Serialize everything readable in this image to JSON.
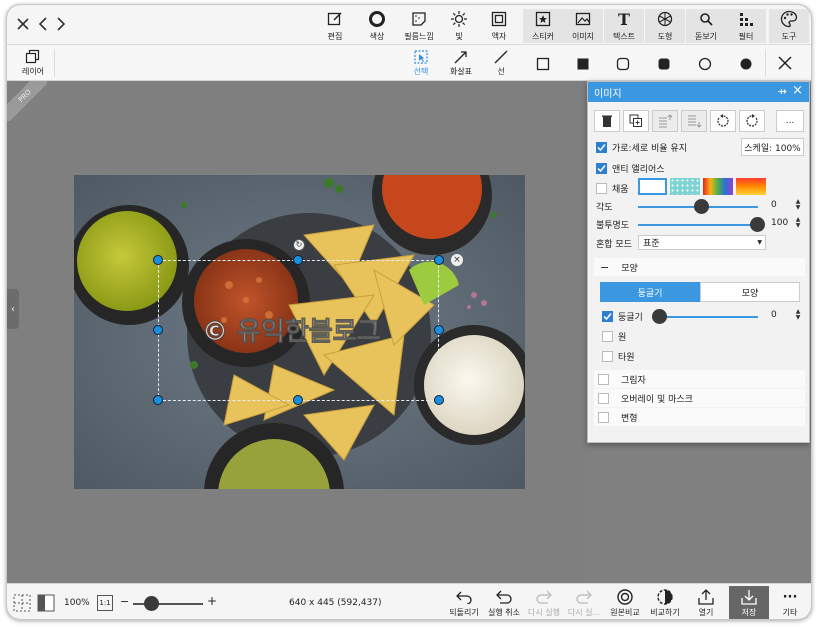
{
  "toolbar": {
    "tools": [
      {
        "icon": "edit-icon",
        "label": "편집"
      },
      {
        "icon": "color-ring-icon",
        "label": "색상"
      },
      {
        "icon": "film-grain-icon",
        "label": "필름느낌"
      },
      {
        "icon": "sun-icon",
        "label": "빛"
      },
      {
        "icon": "frame-icon",
        "label": "액자"
      },
      {
        "icon": "sticker-icon",
        "label": "스티커"
      },
      {
        "icon": "image-icon",
        "label": "이미지"
      },
      {
        "icon": "text-icon",
        "label": "텍스트"
      },
      {
        "icon": "shape-icon",
        "label": "도형"
      },
      {
        "icon": "magnifier-icon",
        "label": "돋보기"
      },
      {
        "icon": "filter-icon",
        "label": "필터"
      },
      {
        "icon": "palette-icon",
        "label": "도구"
      }
    ]
  },
  "subbar": {
    "layer_label": "레이어",
    "select_label": "선택",
    "arrow_label": "화살표",
    "line_label": "선"
  },
  "canvas": {
    "pro_badge": "PRO",
    "watermark_text": "© 유익한블로그"
  },
  "status": {
    "zoom": "100%",
    "one_to_one": "1:1",
    "minus": "−",
    "plus": "+",
    "zoom_level": 0.2,
    "dimensions": "640 x 445 (592,437)",
    "buttons": [
      {
        "icon": "revert-icon",
        "label": "되돌리기",
        "disabled": false
      },
      {
        "icon": "undo-icon",
        "label": "실행 취소",
        "disabled": false
      },
      {
        "icon": "redo-icon",
        "label": "다시 실행",
        "disabled": true
      },
      {
        "icon": "redo-more-icon",
        "label": "다시 실...",
        "disabled": true
      },
      {
        "icon": "compare-original-icon",
        "label": "원본비교",
        "disabled": false
      },
      {
        "icon": "compare-icon",
        "label": "비교하기",
        "disabled": false
      },
      {
        "icon": "open-icon",
        "label": "열기",
        "disabled": false
      },
      {
        "icon": "save-icon",
        "label": "저장",
        "disabled": false
      },
      {
        "icon": "more-icon",
        "label": "기타",
        "disabled": false
      }
    ]
  },
  "panel": {
    "title": "이미지",
    "more_button": "...",
    "keep_ratio_label": "가로:세로 비율 유지",
    "scale_label": "스케일: 100%",
    "antialias_label": "앤티 앨리어스",
    "fill_label": "채움",
    "angle_label": "각도",
    "angle_value": "0",
    "opacity_label": "불투명도",
    "opacity_value": "100",
    "blend_label": "혼합 모드",
    "blend_value": "표준",
    "shape_section": "모양",
    "tab_round": "둥글기",
    "tab_shape": "모양",
    "round_label": "둥글기",
    "round_value": "0",
    "circle_label": "원",
    "ellipse_label": "타원",
    "shadow_label": "그림자",
    "overlay_label": "오버레이 및 마스크",
    "transform_label": "변형"
  },
  "colors": {
    "accent": "#3b98e0",
    "panel_bg": "#f2f2f2",
    "canvas_bg": "#808080"
  }
}
